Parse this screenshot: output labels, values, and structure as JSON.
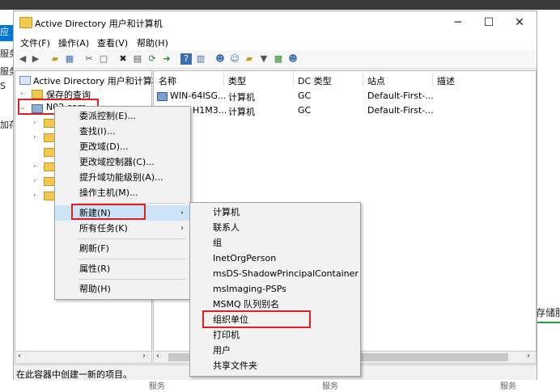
{
  "background": {
    "left_labels": [
      "应",
      "服务",
      "服务",
      "S",
      "加存"
    ],
    "right_label": "存储服",
    "bottom_labels": [
      "服务",
      "服务",
      "服务"
    ]
  },
  "window": {
    "title": "Active Directory 用户和计算机",
    "controls": {
      "minimize": "─",
      "maximize": "☐",
      "close": "✕"
    }
  },
  "menubar": [
    "文件(F)",
    "操作(A)",
    "查看(V)",
    "帮助(H)"
  ],
  "tree": {
    "root": "Active Directory 用户和计算机",
    "saved_queries": "保存的查询",
    "domain": "N02.com"
  },
  "list": {
    "columns": [
      "名称",
      "类型",
      "DC 类型",
      "站点",
      "描述"
    ],
    "rows": [
      {
        "name": "WIN-64ISG...",
        "type": "计算机",
        "dc_type": "GC",
        "site": "Default-First-..."
      },
      {
        "name": "H1M3...",
        "type": "计算机",
        "dc_type": "GC",
        "site": "Default-First-..."
      }
    ]
  },
  "status": "在此容器中创建一新的项目。",
  "context_menu": {
    "items": [
      "委派控制(E)...",
      "查找(I)...",
      "更改域(D)...",
      "更改域控制器(C)...",
      "提升域功能级别(A)...",
      "操作主机(M)...",
      "新建(N)",
      "所有任务(K)",
      "刷新(F)",
      "属性(R)",
      "帮助(H)"
    ]
  },
  "submenu": {
    "items": [
      "计算机",
      "联系人",
      "组",
      "InetOrgPerson",
      "msDS-ShadowPrincipalContainer",
      "msImaging-PSPs",
      "MSMQ 队列别名",
      "组织单位",
      "打印机",
      "用户",
      "共享文件夹"
    ]
  },
  "colors": {
    "highlight": "#cce4f7",
    "annotation_red": "#e02020",
    "accent_blue": "#0078d7"
  }
}
